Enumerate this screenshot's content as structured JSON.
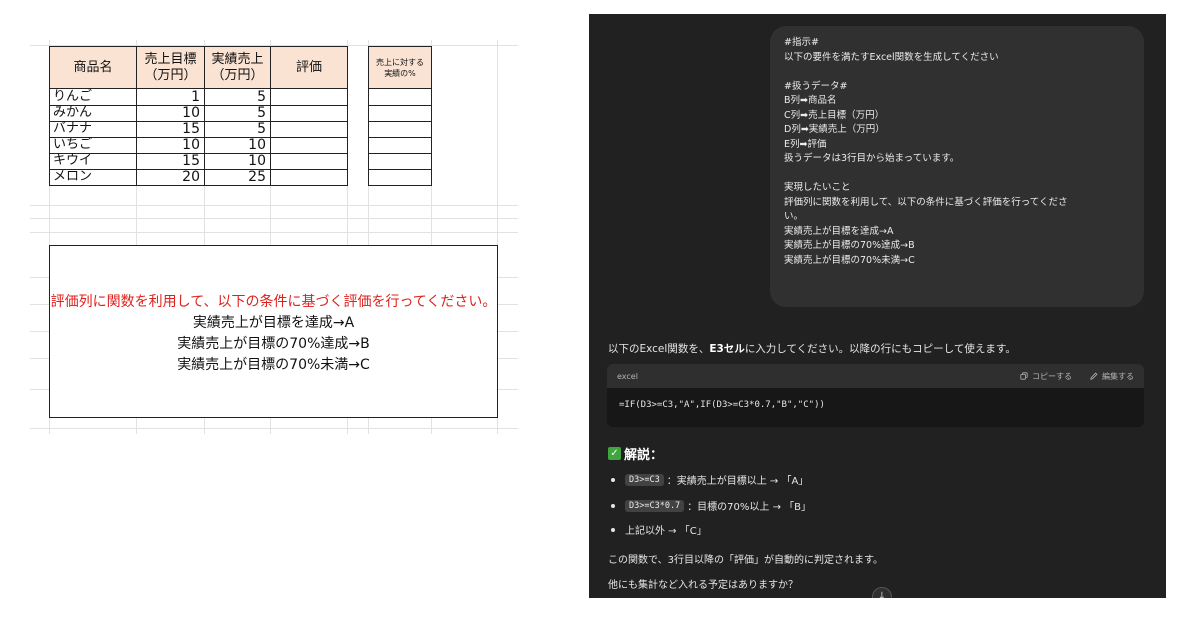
{
  "sheet": {
    "headers": {
      "name": "商品名",
      "target_l1": "売上目標",
      "target_l2": "（万円）",
      "actual_l1": "実績売上",
      "actual_l2": "（万円）",
      "rating": "評価",
      "ratio_l1": "売上に対する",
      "ratio_l2": "実績の%"
    },
    "rows": [
      {
        "name": "りんご",
        "target": "1",
        "actual": "5"
      },
      {
        "name": "みかん",
        "target": "10",
        "actual": "5"
      },
      {
        "name": "バナナ",
        "target": "15",
        "actual": "5"
      },
      {
        "name": "いちご",
        "target": "10",
        "actual": "10"
      },
      {
        "name": "キウイ",
        "target": "15",
        "actual": "10"
      },
      {
        "name": "メロン",
        "target": "20",
        "actual": "25"
      }
    ],
    "note": {
      "instruction": "評価列に関数を利用して、以下の条件に基づく評価を行ってください。",
      "line1": "実績売上が目標を達成→A",
      "line2": "実績売上が目標の70%達成→B",
      "line3": "実績売上が目標の70%未満→C"
    }
  },
  "chat": {
    "user_lines": [
      "#指示#",
      "以下の要件を満たすExcel関数を生成してください",
      "",
      "#扱うデータ#",
      "B列➡商品名",
      "C列➡売上目標（万円）",
      "D列➡実績売上（万円）",
      "E列➡評価",
      "扱うデータは3行目から始まっています。",
      "",
      "実現したいこと",
      "評価列に関数を利用して、以下の条件に基づく評価を行ってくださ",
      "い。",
      "実績売上が目標を達成→A",
      "実績売上が目標の70%達成→B",
      "実績売上が目標の70%未満→C"
    ],
    "intro_pre": "以下のExcel関数を、",
    "intro_bold": "E3セル",
    "intro_post": "に入力してください。以降の行にもコピーして使えます。",
    "code_lang": "excel",
    "copy_label": "コピーする",
    "edit_label": "編集する",
    "code": "=IF(D3>=C3,\"A\",IF(D3>=C3*0.7,\"B\",\"C\"))",
    "explain_title": "解説：",
    "bullets": [
      {
        "code": "D3>=C3",
        "text": "：実績売上が目標以上 → 「A」"
      },
      {
        "code": "D3>=C3*0.7",
        "text": "：目標の70%以上 → 「B」"
      },
      {
        "code": "",
        "text": "上記以外 → 「C」"
      }
    ],
    "summary": "この関数で、3行目以降の「評価」が自動的に判定されます。",
    "question": "他にも集計など入れる予定はありますか？"
  },
  "colors": {
    "header_fill": "#fbe3d3",
    "note_red": "#e0201c",
    "chat_bg": "#212121",
    "bubble_bg": "#303030",
    "check_green": "#3fa63f"
  },
  "icons": {
    "copy": "copy-icon",
    "edit": "edit-icon",
    "check": "check-icon",
    "scroll": "arrow-down-icon"
  }
}
